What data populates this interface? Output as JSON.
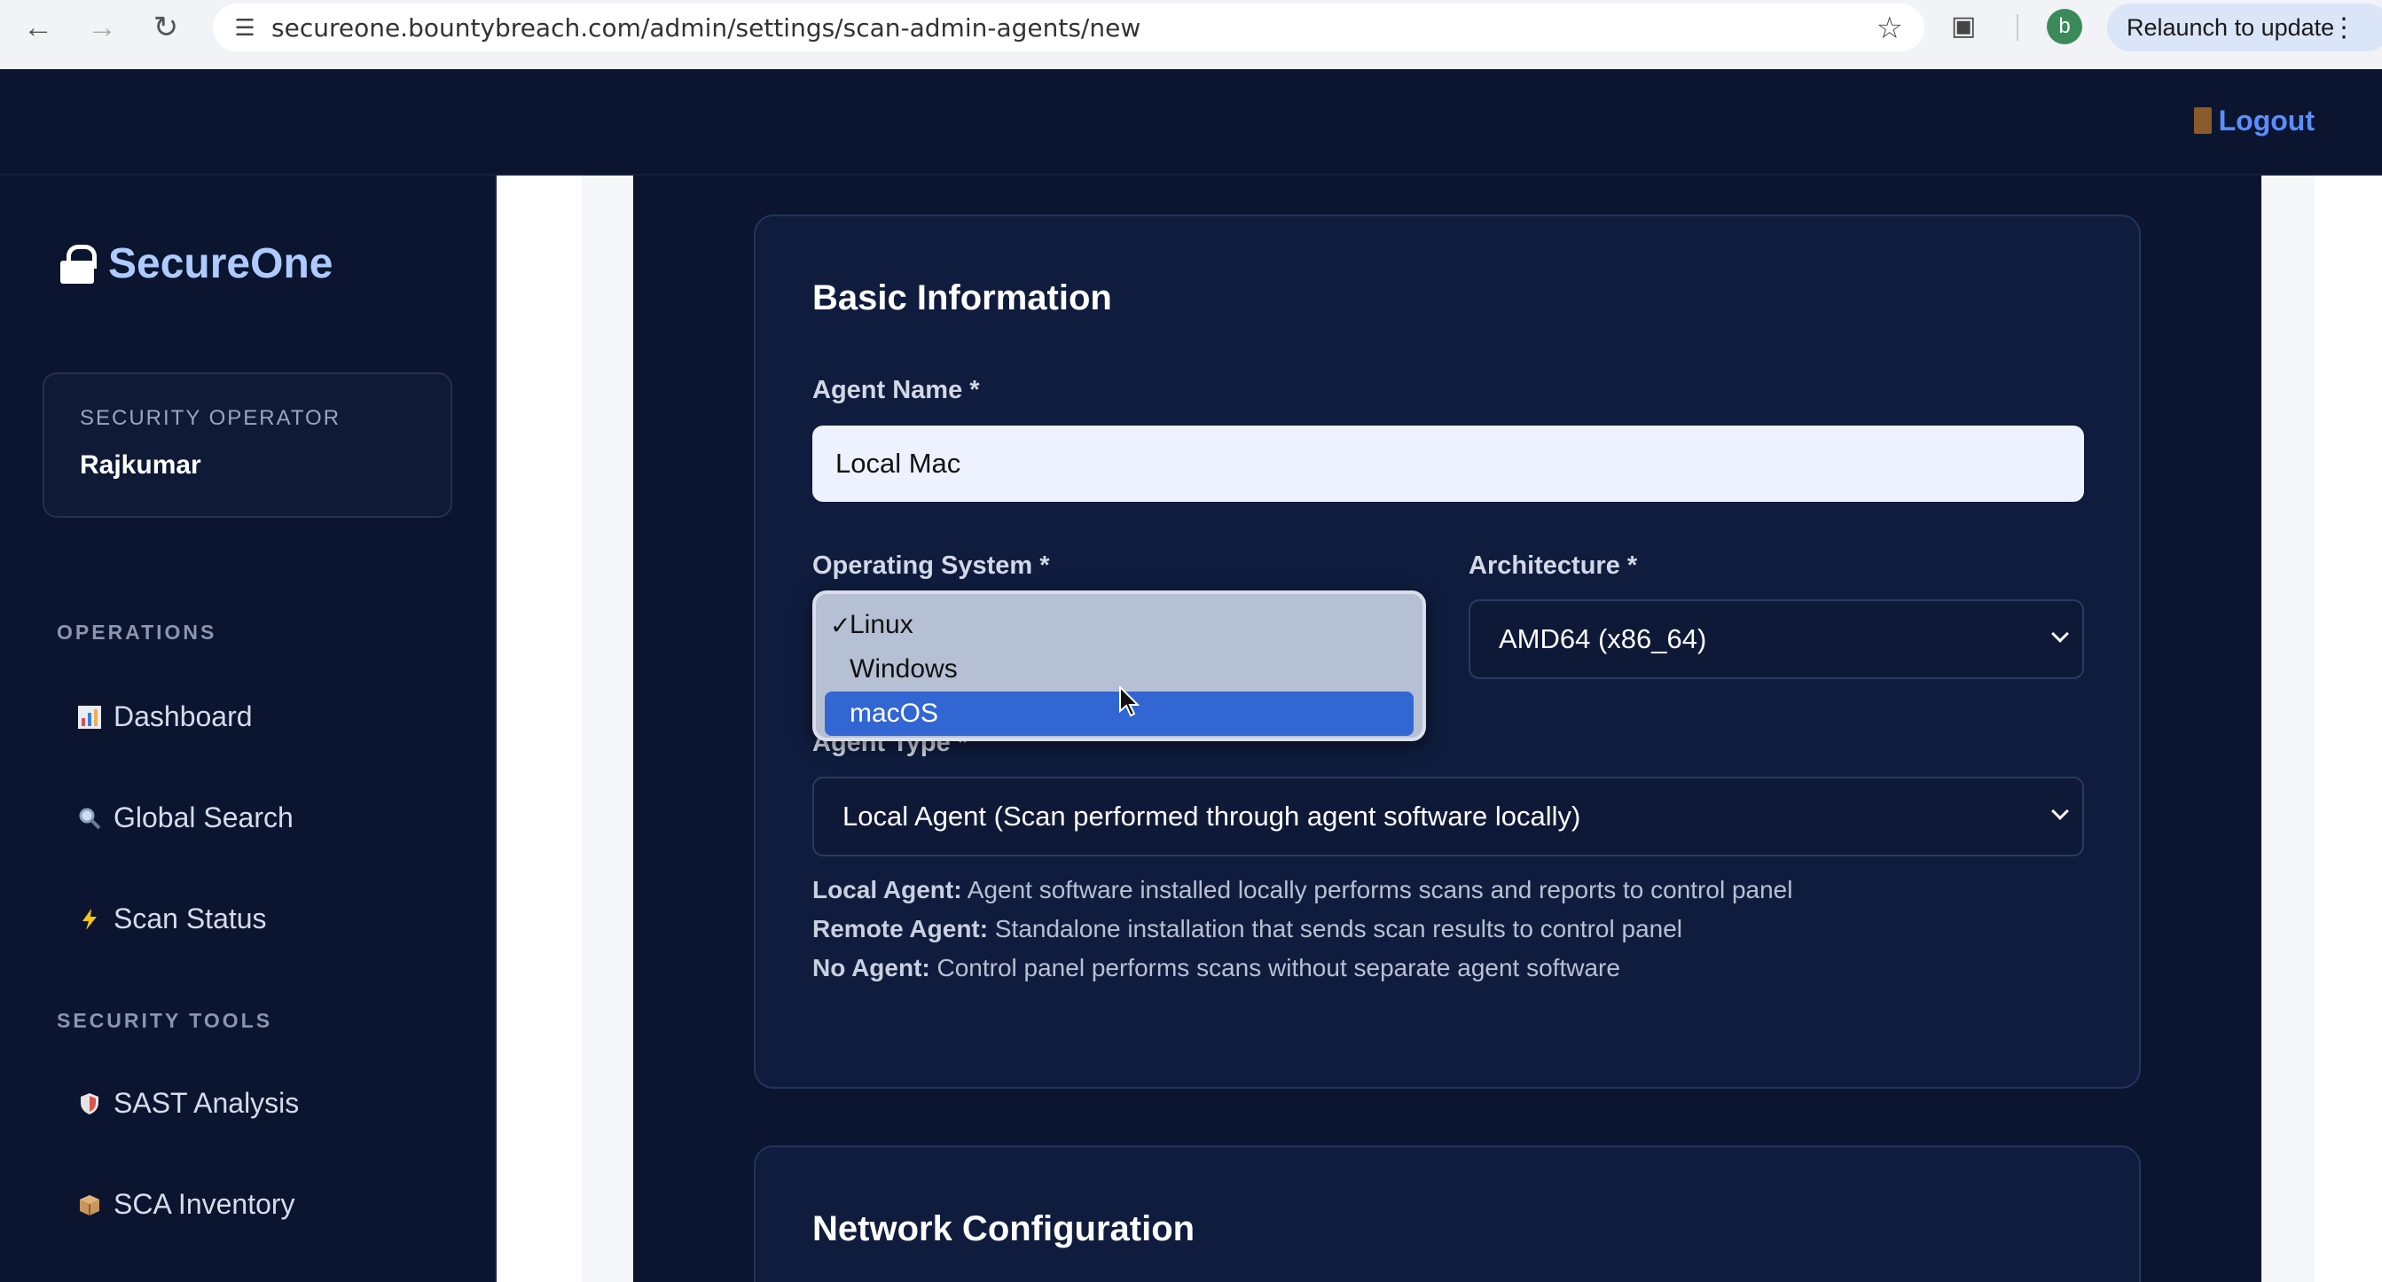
{
  "browser": {
    "url": "secureone.bountybreach.com/admin/settings/scan-admin-agents/new",
    "profile_initial": "b",
    "relaunch_label": "Relaunch to update"
  },
  "header": {
    "logout_label": "Logout"
  },
  "sidebar": {
    "brand": "SecureOne",
    "operator_role": "SECURITY OPERATOR",
    "operator_name": "Rajkumar",
    "sections": [
      {
        "label": "OPERATIONS",
        "items": [
          {
            "label": "Dashboard",
            "icon": "chart-icon"
          },
          {
            "label": "Global Search",
            "icon": "magnifier-icon"
          },
          {
            "label": "Scan Status",
            "icon": "lightning-icon"
          }
        ]
      },
      {
        "label": "SECURITY TOOLS",
        "items": [
          {
            "label": "SAST Analysis",
            "icon": "shield-icon"
          },
          {
            "label": "SCA Inventory",
            "icon": "package-icon"
          }
        ]
      }
    ]
  },
  "form": {
    "basic_title": "Basic Information",
    "agent_name_label": "Agent Name *",
    "agent_name_value": "Local Mac",
    "os_label": "Operating System *",
    "os_options": [
      "Linux",
      "Windows",
      "macOS"
    ],
    "os_checked": "Linux",
    "os_highlighted": "macOS",
    "arch_label": "Architecture *",
    "arch_value": "AMD64 (x86_64)",
    "agent_type_label": "Agent Type *",
    "agent_type_value": "Local Agent (Scan performed through agent software locally)",
    "descriptions": [
      {
        "term": "Local Agent:",
        "text": " Agent software installed locally performs scans and reports to control panel"
      },
      {
        "term": "Remote Agent:",
        "text": " Standalone installation that sends scan results to control panel"
      },
      {
        "term": "No Agent:",
        "text": " Control panel performs scans without separate agent software"
      }
    ],
    "network_title": "Network Configuration"
  },
  "colors": {
    "accent": "#5b8dff",
    "selected_option": "#3266d3",
    "background": "#0b1530"
  }
}
